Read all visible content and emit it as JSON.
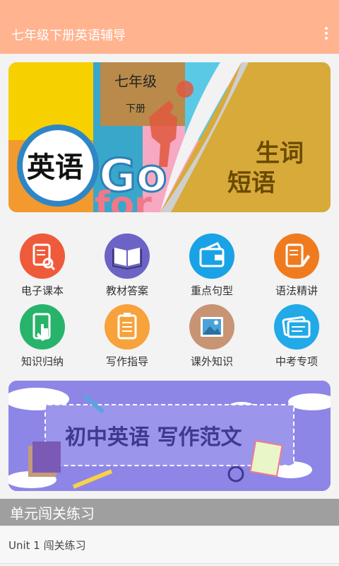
{
  "app": {
    "title": "七年级下册英语辅导"
  },
  "banner_top": {
    "grade": "七年级",
    "volume": "下册",
    "subject": "英语",
    "go_text": "Go",
    "for_text": "for",
    "right_line1": "生词",
    "right_line2": "短语"
  },
  "grid": {
    "items": [
      {
        "label": "电子课本",
        "color": "#ef5a3b"
      },
      {
        "label": "教材答案",
        "color": "#6d63c6"
      },
      {
        "label": "重点句型",
        "color": "#1aa2e6"
      },
      {
        "label": "语法精讲",
        "color": "#f07b1e"
      },
      {
        "label": "知识归纳",
        "color": "#27b46a"
      },
      {
        "label": "写作指导",
        "color": "#f7a23a"
      },
      {
        "label": "课外知识",
        "color": "#c89473"
      },
      {
        "label": "中考专项",
        "color": "#22a9e8"
      }
    ]
  },
  "banner_bottom": {
    "title": "初中英语 写作范文"
  },
  "section": {
    "title": "单元闯关练习"
  },
  "list": {
    "item1": "Unit 1 闯关练习"
  }
}
